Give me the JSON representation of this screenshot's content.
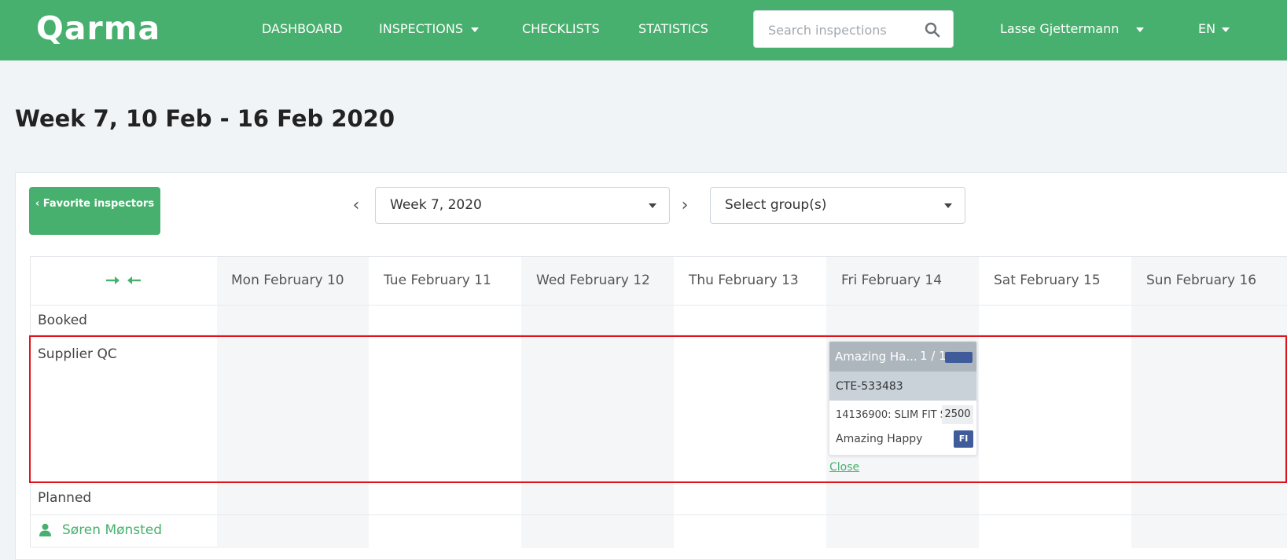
{
  "header": {
    "logo": "Qarma",
    "nav": [
      {
        "label": "DASHBOARD"
      },
      {
        "label": "INSPECTIONS"
      },
      {
        "label": "CHECKLISTS"
      },
      {
        "label": "STATISTICS"
      }
    ],
    "search_placeholder": "Search inspections",
    "user": "Lasse Gjettermann",
    "language": "EN"
  },
  "page": {
    "title": "Week 7, 10 Feb - 16 Feb 2020"
  },
  "toolbar": {
    "favorite_button": "‹ Favorite inspectors",
    "prev_arrow": "‹",
    "next_arrow": "›",
    "week_select": "Week 7, 2020",
    "group_select": "Select group(s)"
  },
  "calendar": {
    "days": [
      "Mon February 10",
      "Tue February 11",
      "Wed February 12",
      "Thu February 13",
      "Fri February 14",
      "Sat February 15",
      "Sun February 16"
    ],
    "rows": {
      "booked": "Booked",
      "supplier_qc": "Supplier QC",
      "planned": "Planned"
    },
    "inspector": "Søren Mønsted"
  },
  "card": {
    "title": "Amazing Ha...",
    "count": "1 / 1",
    "reference": "CTE-533483",
    "item": "14136900: SLIM FIT SI",
    "quantity": "2500",
    "supplier": "Amazing Happy",
    "badge": "FI",
    "close": "Close"
  },
  "colors": {
    "brand_green": "#48b06e",
    "highlight_red": "#e0131b",
    "tag_blue": "#3f5b9a"
  }
}
